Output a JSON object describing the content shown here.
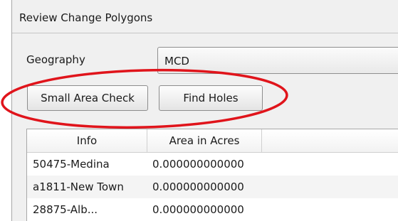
{
  "window": {
    "title": "Review Change Polygons"
  },
  "geography": {
    "label": "Geography",
    "selected": "MCD"
  },
  "buttons": {
    "small_area_check": "Small Area Check",
    "find_holes": "Find Holes"
  },
  "table": {
    "columns": [
      "Info",
      "Area in Acres"
    ],
    "rows": [
      {
        "info": "50475-Medina",
        "area": "0.000000000000"
      },
      {
        "info": "a1811-New Town",
        "area": "0.000000000000"
      },
      {
        "info": "28875-Alb...",
        "area": "0.000000000000"
      }
    ]
  },
  "annotation": {
    "shape": "ellipse",
    "color": "#e0141b"
  }
}
